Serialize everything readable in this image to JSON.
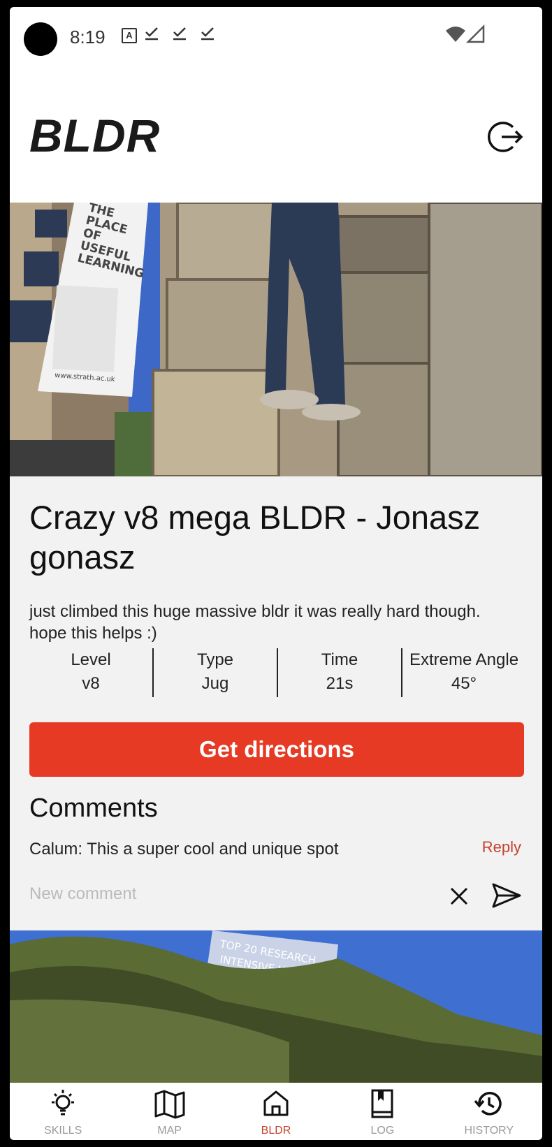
{
  "status_bar": {
    "time": "8:19"
  },
  "header": {
    "logo": "BLDR"
  },
  "post": {
    "title": "Crazy v8 mega BLDR - Jonasz gonasz",
    "description": "just climbed this huge massive bldr it was really hard though. hope this helps :)",
    "stats": [
      {
        "label": "Level",
        "value": "v8"
      },
      {
        "label": "Type",
        "value": "Jug"
      },
      {
        "label": "Time",
        "value": "21s"
      },
      {
        "label": "Extreme Angle",
        "value": "45°"
      }
    ],
    "directions_label": "Get directions",
    "comments_heading": "Comments",
    "comments": [
      {
        "text": "Calum: This a super cool and unique spot",
        "reply_label": "Reply"
      }
    ],
    "new_comment_placeholder": "New comment",
    "photo_sign_text": [
      "THE",
      "PLACE",
      "OF",
      "USEFUL",
      "LEARNING"
    ],
    "photo_sign_url": "www.strath.ac.uk",
    "photo2_sign_text": [
      "TOP 20 RESEARCH",
      "INTENSIVE UNIVERSITY"
    ]
  },
  "nav": [
    {
      "label": "SKILLS",
      "icon": "lightbulb-icon"
    },
    {
      "label": "MAP",
      "icon": "map-icon"
    },
    {
      "label": "BLDR",
      "icon": "home-icon",
      "active": true
    },
    {
      "label": "LOG",
      "icon": "book-icon"
    },
    {
      "label": "HISTORY",
      "icon": "history-icon"
    }
  ],
  "colors": {
    "accent": "#e63a24",
    "active_nav": "#c8402d"
  }
}
